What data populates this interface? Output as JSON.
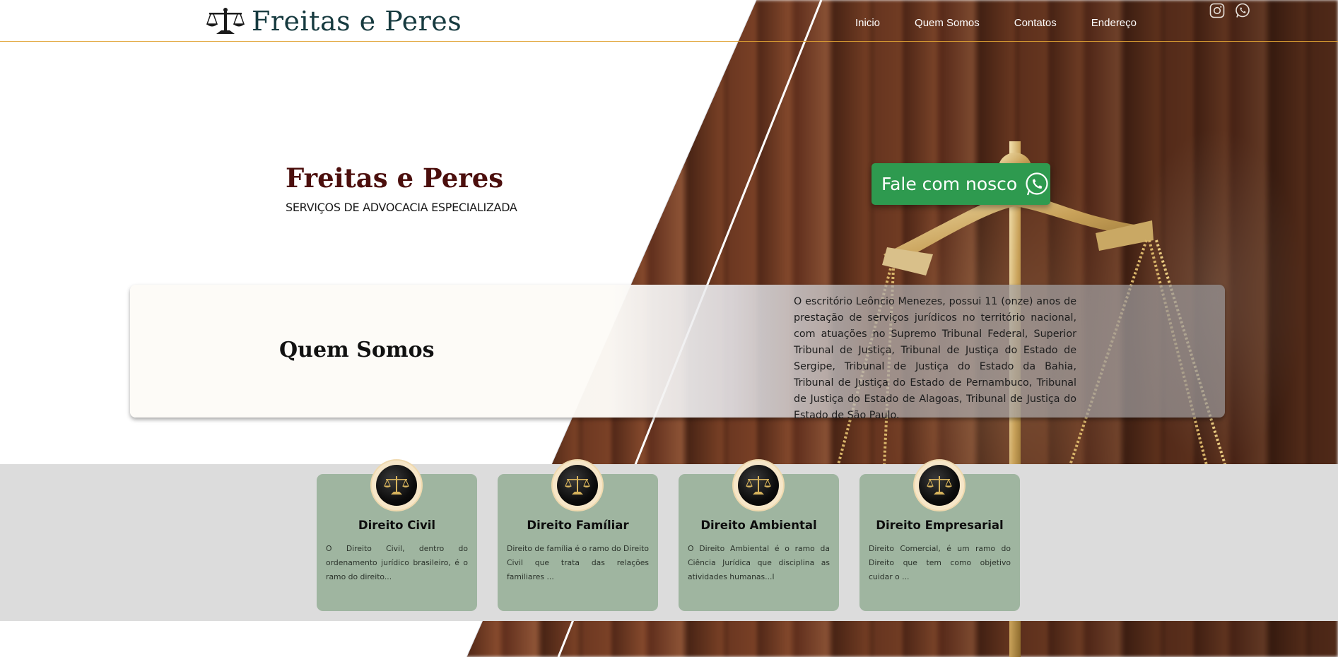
{
  "header": {
    "brand_name": "Freitas e Peres",
    "nav": [
      "Inicio",
      "Quem Somos",
      "Contatos",
      "Endereço"
    ],
    "social_icons": [
      "instagram-icon",
      "whatsapp-icon"
    ],
    "accent_color": "#e0a233"
  },
  "hero": {
    "title": "Freitas e Peres",
    "subtitle": "SERVIÇOS DE ADVOCACIA ESPECIALIZADA",
    "cta_label": "Fale com nosco",
    "cta_color": "#2e9a4f"
  },
  "about": {
    "title": "Quem Somos",
    "text": "O escritório Leôncio Menezes, possui 11 (onze) anos de prestação de serviços jurídicos no território nacional, com atuações no Supremo Tribunal Federal, Superior Tribunal de Justiça, Tribunal de Justiça do Estado de Sergipe, Tribunal de Justiça do Estado da Bahia, Tribunal de Justiça do Estado de Pernambuco, Tribunal de Justiça do Estado de Alagoas, Tribunal de Justiça do Estado de São Paulo."
  },
  "services": [
    {
      "title": "Direito Civil",
      "text": "O Direito Civil, dentro do ordenamento jurídico brasileiro, é o ramo do direito..."
    },
    {
      "title": "Direito Famíliar",
      "text": "Direito de família é o ramo do Direito Civil que trata das relações familiares ..."
    },
    {
      "title": "Direito Ambiental",
      "text": "O Direito Ambiental é o ramo da Ciência Jurídica que disciplina as atividades humanas...l"
    },
    {
      "title": "Direito Empresarial",
      "text": "Direito Comercial, é um ramo do Direito que tem como objetivo cuidar o ..."
    }
  ],
  "colors": {
    "card_bg": "#9fb5a0",
    "band_bg": "#dcdcdc",
    "brand_text": "#163a3f",
    "hero_title": "#4c0f0d"
  }
}
